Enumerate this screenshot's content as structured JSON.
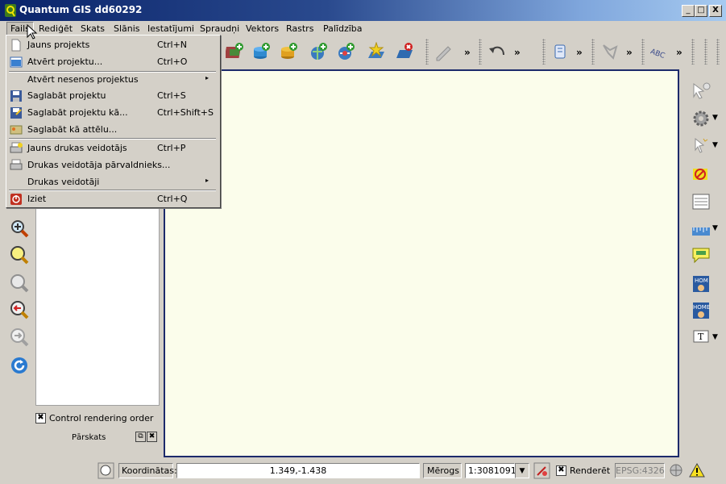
{
  "window": {
    "title": "Quantum GIS dd60292",
    "controls": {
      "minimize": "_",
      "maximize": "□",
      "close": "X"
    }
  },
  "menubar": {
    "items": [
      {
        "label": "Fails",
        "active": true
      },
      {
        "label": "Rediģēt"
      },
      {
        "label": "Skats"
      },
      {
        "label": "Slānis"
      },
      {
        "label": "Iestatījumi"
      },
      {
        "label": "Spraudņi"
      },
      {
        "label": "Vektors"
      },
      {
        "label": "Rastrs"
      },
      {
        "label": "Palīdzība"
      }
    ]
  },
  "file_menu": {
    "items": [
      {
        "label": "Jauns projekts",
        "shortcut": "Ctrl+N",
        "icon": "new-project-icon"
      },
      {
        "label": "Atvērt projektu...",
        "shortcut": "Ctrl+O",
        "icon": "open-project-icon"
      },
      {
        "label": "Atvērt nesenos projektus",
        "submenu": "▸"
      },
      {
        "label": "Saglabāt projektu",
        "shortcut": "Ctrl+S",
        "icon": "save-project-icon"
      },
      {
        "label": "Saglabāt projektu kā...",
        "shortcut": "Ctrl+Shift+S",
        "icon": "save-as-icon"
      },
      {
        "label": "Saglabāt kā attēlu...",
        "icon": "save-image-icon"
      },
      {
        "label": "Jauns drukas veidotājs",
        "shortcut": "Ctrl+P",
        "icon": "new-composer-icon"
      },
      {
        "label": "Drukas veidotāja pārvaldnieks...",
        "icon": "composer-manager-icon"
      },
      {
        "label": "Drukas veidotāji",
        "submenu": "▸"
      },
      {
        "label": "Iziet",
        "shortcut": "Ctrl+Q",
        "icon": "exit-icon"
      }
    ]
  },
  "toolbar": {
    "overflow": "»"
  },
  "layers_panel": {
    "control_rendering_order": {
      "label": "Control rendering order",
      "checked": true,
      "mark": "✖"
    }
  },
  "overview_panel": {
    "title": "Pārskats",
    "float": "⧉",
    "close": "✖"
  },
  "statusbar": {
    "coordinates_label": "Koordinātas:",
    "coordinates_value": "1.349,-1.438",
    "scale_label": "Mērogs",
    "scale_value": "1:3081091",
    "scale_arrow": "▼",
    "render_label": "Renderēt",
    "render_checked": true,
    "render_mark": "✖",
    "crs_label": "EPSG:4326"
  },
  "colors": {
    "canvas_bg": "#fbfdeb",
    "canvas_border": "#1c2a6b",
    "title_start": "#0a246a",
    "title_end": "#a6caf0"
  }
}
